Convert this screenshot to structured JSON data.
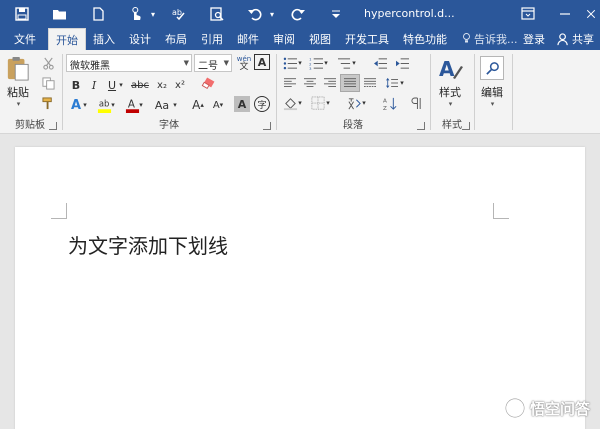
{
  "title_bar": {
    "doc_title": "hypercontrol.d...",
    "quick_access": [
      "save-icon",
      "open-icon",
      "new-icon",
      "touch-mode-icon",
      "spelling-icon",
      "print-preview-icon",
      "undo-icon",
      "redo-icon",
      "customize-icon"
    ],
    "window_controls": [
      "restore-icon",
      "minimize-icon",
      "close-icon"
    ]
  },
  "tabs": {
    "items": [
      "文件",
      "开始",
      "插入",
      "设计",
      "布局",
      "引用",
      "邮件",
      "审阅",
      "视图",
      "开发工具",
      "特色功能"
    ],
    "active": "开始",
    "tell_me": "告诉我...",
    "login": "登录",
    "share": "共享"
  },
  "ribbon": {
    "clipboard": {
      "label": "剪贴板",
      "paste": "粘贴"
    },
    "font": {
      "label": "字体",
      "font_name": "微软雅黑",
      "font_size": "二号",
      "bold": "B",
      "italic": "I",
      "underline": "U",
      "strikethrough": "abc",
      "subscript": "x₂",
      "superscript": "x²",
      "grow": "A",
      "shrink": "A",
      "change_case": "Aa",
      "phonetic": "wén",
      "char_border": "A",
      "char_shading": "A",
      "enclose": "字",
      "highlight_color": "#ffff00",
      "font_color": "#c00000"
    },
    "paragraph": {
      "label": "段落"
    },
    "styles": {
      "label": "样式",
      "button": "样式"
    },
    "editing": {
      "button": "编辑"
    }
  },
  "document": {
    "text": "为文字添加下划线"
  },
  "watermark": {
    "text": "悟空问答"
  },
  "colors": {
    "brand": "#2b579a",
    "ribbon_bg": "#f3f3f3",
    "canvas_bg": "#e6e6e6"
  }
}
